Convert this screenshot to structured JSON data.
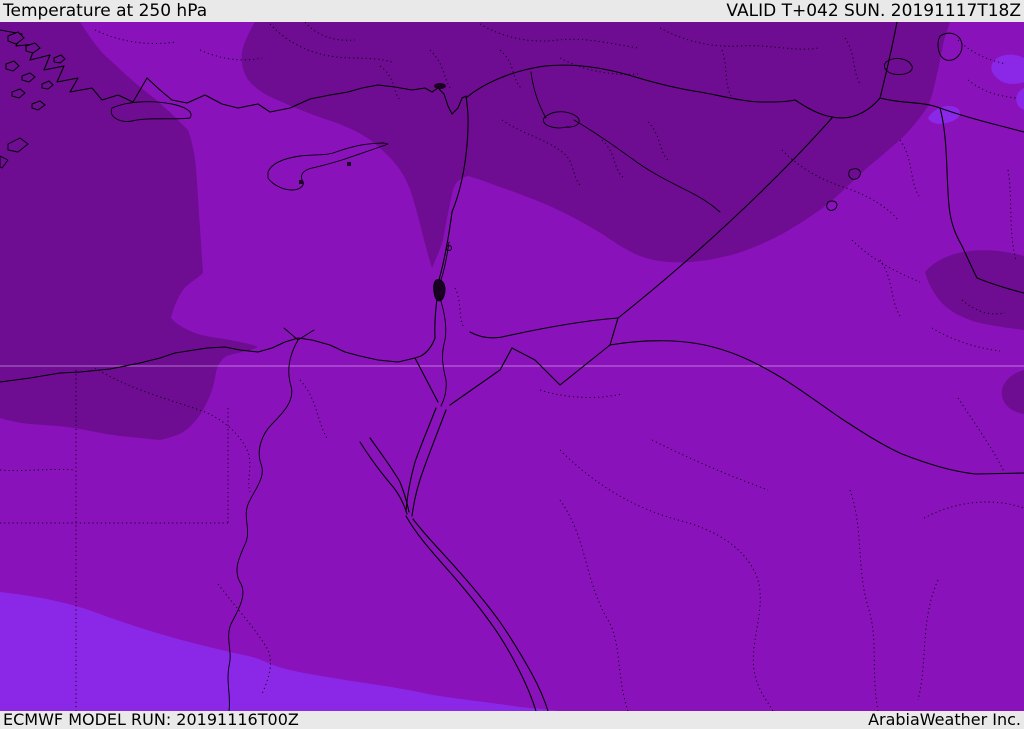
{
  "header": {
    "title": "Temperature at 250 hPa",
    "valid": "VALID T+042 SUN. 20191117T18Z"
  },
  "footer": {
    "model_run": "ECMWF MODEL RUN: 20191116T00Z",
    "brand": "ArabiaWeather Inc."
  },
  "map": {
    "colors": {
      "base_shade": "#8a12bb",
      "cold_dark_shade": "#6e0d92",
      "warm_violet_shade": "#8b28e8",
      "border_line": "#000000",
      "latitude_line": "#ecc6f2",
      "bar_background": "#e9e9e9",
      "bar_text": "#000000"
    }
  }
}
